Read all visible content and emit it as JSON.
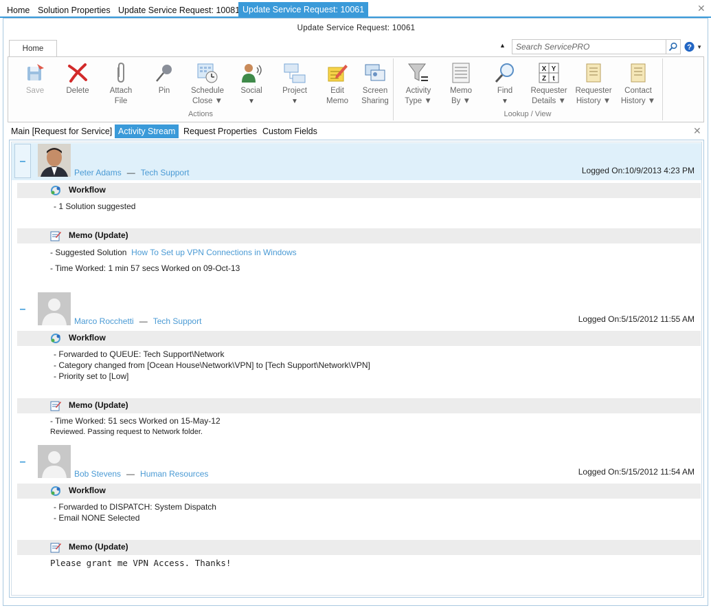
{
  "doc_tabs": [
    {
      "label": "Home"
    },
    {
      "label": "Solution Properties"
    },
    {
      "label": "Update Service Request: 10081"
    },
    {
      "label": "Update Service Request: 10061"
    }
  ],
  "window_title": "Update Service Request: 10061",
  "ribbon": {
    "tab": "Home",
    "search_placeholder": "Search ServicePRO",
    "groups": [
      {
        "label": "Actions"
      },
      {
        "label": "Lookup / View"
      }
    ],
    "buttons": {
      "save": {
        "line1": "Save"
      },
      "delete": {
        "line1": "Delete"
      },
      "attach": {
        "line1": "Attach",
        "line2": "File"
      },
      "pin": {
        "line1": "Pin"
      },
      "schedule": {
        "line1": "Schedule",
        "line2": "Close ▼"
      },
      "social": {
        "line1": "Social",
        "line2": "▼"
      },
      "project": {
        "line1": "Project",
        "line2": "▼"
      },
      "edit_memo": {
        "line1": "Edit",
        "line2": "Memo"
      },
      "screen": {
        "line1": "Screen",
        "line2": "Sharing"
      },
      "activity": {
        "line1": "Activity",
        "line2": "Type ▼"
      },
      "memo_by": {
        "line1": "Memo",
        "line2": "By ▼"
      },
      "find": {
        "line1": "Find",
        "line2": "▼"
      },
      "req_details": {
        "line1": "Requester",
        "line2": "Details ▼"
      },
      "req_history": {
        "line1": "Requester",
        "line2": "History ▼"
      },
      "contact_history": {
        "line1": "Contact",
        "line2": "History ▼"
      }
    }
  },
  "sub_tabs": [
    {
      "label": "Main [Request for Service]"
    },
    {
      "label": "Activity Stream"
    },
    {
      "label": "Request Properties"
    },
    {
      "label": "Custom Fields"
    }
  ],
  "entries": [
    {
      "name": "Peter Adams",
      "dept": "Tech Support",
      "logged": "Logged On:10/9/2013 4:23 PM",
      "workflow_title": "Workflow",
      "workflow_lines": [
        "- 1 Solution suggested"
      ],
      "memo_title": "Memo (Update)",
      "memo_prefix": "- Suggested Solution",
      "memo_link": "How To Set up VPN Connections in Windows",
      "memo_lines": [
        "- Time Worked: 1 min 57 secs Worked on 09-Oct-13"
      ]
    },
    {
      "name": "Marco Rocchetti",
      "dept": "Tech Support",
      "logged": "Logged On:5/15/2012 11:55 AM",
      "workflow_title": "Workflow",
      "workflow_lines": [
        "- Forwarded to QUEUE: Tech Support\\Network",
        "- Category changed from [Ocean House\\Network\\VPN] to [Tech Support\\Network\\VPN]",
        "- Priority set to [Low]"
      ],
      "memo_title": "Memo (Update)",
      "memo_lines": [
        "- Time Worked: 51 secs Worked on 15-May-12",
        "Reviewed. Passing request to Network folder."
      ]
    },
    {
      "name": "Bob Stevens",
      "dept": "Human Resources",
      "logged": "Logged On:5/15/2012 11:54 AM",
      "workflow_title": "Workflow",
      "workflow_lines": [
        "- Forwarded to DISPATCH: System Dispatch",
        "- Email NONE Selected"
      ],
      "memo_title": "Memo (Update)",
      "memo_lines": [
        "Please grant me VPN Access.  Thanks!"
      ]
    }
  ],
  "colors": {
    "accent": "#3a9ad9",
    "link": "#4a9ad4",
    "section_bg": "#ececec",
    "selected_bg": "#dff0fa"
  }
}
